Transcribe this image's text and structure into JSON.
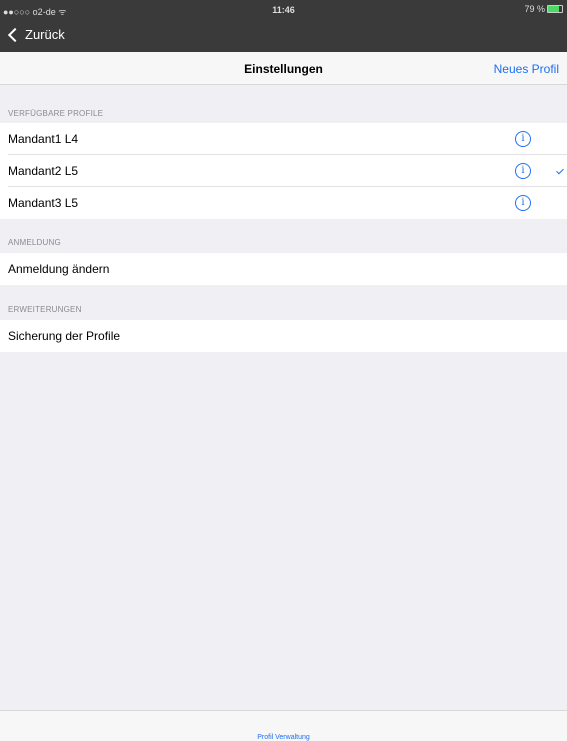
{
  "status": {
    "carrier": "●●○○○ o2-de ᯤ",
    "time": "11:46",
    "battery": "79 %"
  },
  "nav": {
    "back": "Zurück",
    "title": "Einstellungen",
    "new_profile": "Neues Profil"
  },
  "sections": {
    "profiles": {
      "header": "VERFÜGBARE PROFILE",
      "items": [
        {
          "label": "Mandant1 L4"
        },
        {
          "label": "Mandant2 L5",
          "selected": true
        },
        {
          "label": "Mandant3 L5"
        }
      ]
    },
    "login": {
      "header": "ANMELDUNG",
      "item": "Anmeldung ändern"
    },
    "extensions": {
      "header": "ERWEITERUNGEN",
      "item": "Sicherung der Profile"
    }
  },
  "toolbar": {
    "label": "Profil Verwaltung"
  },
  "icons": {
    "info": "info-icon",
    "check": "checkmark-icon",
    "back": "chevron-left-icon"
  },
  "colors": {
    "accent": "#1e6ff0",
    "background": "#efeff4",
    "topbar": "#3a3a3a"
  }
}
